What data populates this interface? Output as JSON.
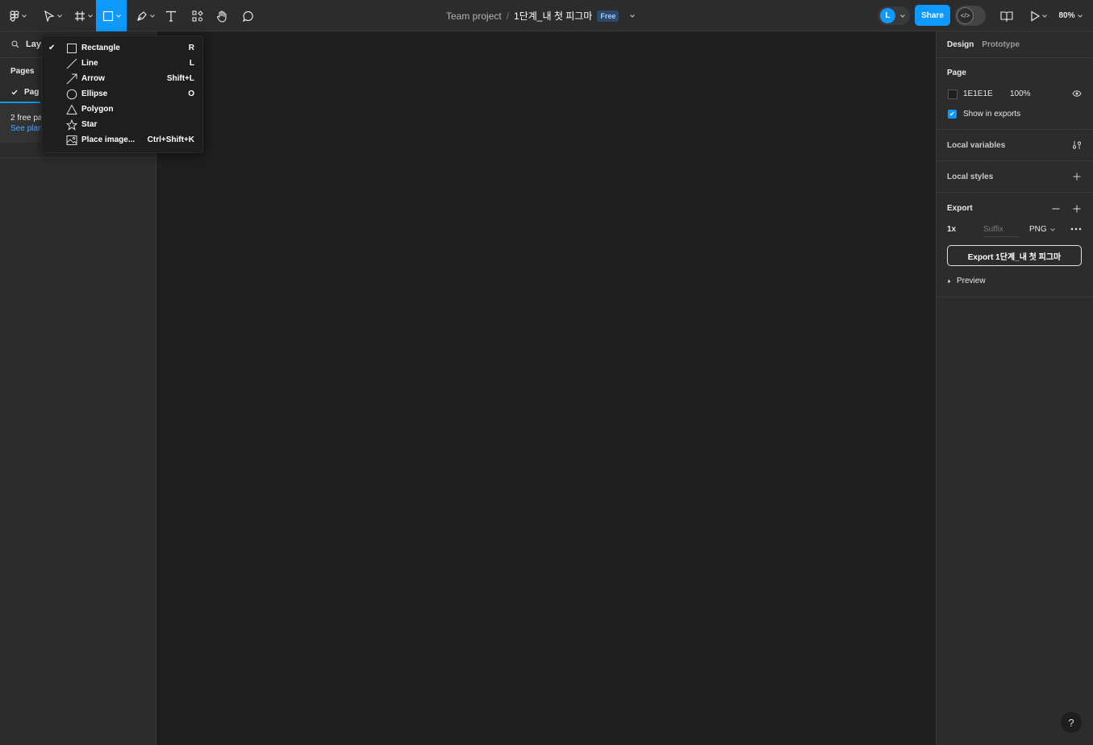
{
  "toolbar": {
    "title_team": "Team project",
    "title_sep": "/",
    "title_file": "1단계_내 첫 피그마",
    "badge": "Free",
    "avatar_initial": "L",
    "share_label": "Share",
    "dev_mode_glyph": "</>",
    "zoom": "80%",
    "icons": [
      "figma-menu-icon",
      "move-tool-icon",
      "frame-tool-icon",
      "rectangle-tool-icon",
      "pen-tool-icon",
      "text-tool-icon",
      "resources-icon",
      "hand-tool-icon",
      "comment-icon",
      "library-icon",
      "present-icon"
    ]
  },
  "left_panel": {
    "search_label": "Laye",
    "pages_heading": "Pages",
    "page_item": "Pag",
    "free_notice": "2 free pa",
    "see_plans": "See plan"
  },
  "shape_menu": {
    "items": [
      {
        "label": "Rectangle",
        "shortcut": "R",
        "checked": true,
        "icon": "rectangle-icon"
      },
      {
        "label": "Line",
        "shortcut": "L",
        "checked": false,
        "icon": "line-icon"
      },
      {
        "label": "Arrow",
        "shortcut": "Shift+L",
        "checked": false,
        "icon": "arrow-icon"
      },
      {
        "label": "Ellipse",
        "shortcut": "O",
        "checked": false,
        "icon": "ellipse-icon"
      },
      {
        "label": "Polygon",
        "shortcut": "",
        "checked": false,
        "icon": "polygon-icon"
      },
      {
        "label": "Star",
        "shortcut": "",
        "checked": false,
        "icon": "star-icon"
      },
      {
        "label": "Place image...",
        "shortcut": "Ctrl+Shift+K",
        "checked": false,
        "icon": "image-icon"
      }
    ]
  },
  "right_panel": {
    "tab_design": "Design",
    "tab_prototype": "Prototype",
    "page_heading": "Page",
    "page_color": "1E1E1E",
    "page_opacity": "100%",
    "show_in_exports": "Show in exports",
    "local_variables": "Local variables",
    "local_styles": "Local styles",
    "export_heading": "Export",
    "export_scale": "1x",
    "export_suffix_placeholder": "Suffix",
    "export_format": "PNG",
    "export_button": "Export 1단계_내 첫 피그마",
    "preview": "Preview"
  },
  "help_label": "?",
  "colors": {
    "accent": "#0d99ff",
    "panel": "#2c2c2c",
    "canvas": "#1e1e1e"
  }
}
